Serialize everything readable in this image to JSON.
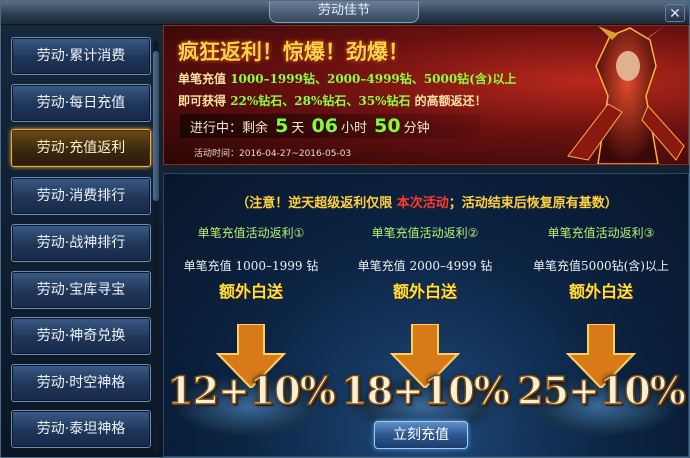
{
  "window": {
    "title": "劳动佳节",
    "close_label": "✕"
  },
  "sidebar": {
    "items": [
      {
        "label": "劳动·累计消费",
        "active": false
      },
      {
        "label": "劳动·每日充值",
        "active": false
      },
      {
        "label": "劳动·充值返利",
        "active": true
      },
      {
        "label": "劳动·消费排行",
        "active": false
      },
      {
        "label": "劳动·战神排行",
        "active": false
      },
      {
        "label": "劳动·宝库寻宝",
        "active": false
      },
      {
        "label": "劳动·神奇兑换",
        "active": false
      },
      {
        "label": "劳动·时空神格",
        "active": false
      },
      {
        "label": "劳动·泰坦神格",
        "active": false
      }
    ]
  },
  "banner": {
    "headline": "疯狂返利！惊爆！劲爆！",
    "line1_prefix": "单笔充值 ",
    "line1_ranges": "1000–1999钻、2000–4999钻、5000钻(含)以上",
    "line2_prefix": "即可获得 ",
    "line2_rates": "22%钻石、28%钻石、35%钻石",
    "line2_suffix": " 的高额返还！",
    "countdown": {
      "prefix": "进行中：剩余",
      "days": "5",
      "days_unit": "天",
      "hours": "06",
      "hours_unit": "小时",
      "minutes": "50",
      "minutes_unit": "分钟"
    },
    "date_text": "活动时间：2016-04-27~2016-05-03"
  },
  "notice": {
    "part1": "（注意！逆天超级返利仅限 ",
    "highlight": "本次活动",
    "part2": "；活动结束后恢复原有基数）"
  },
  "tiers": [
    {
      "title": "单笔充值活动返利①",
      "desc": "单笔充值 1000–1999 钻",
      "extra": "额外白送",
      "bonus": "12+10%"
    },
    {
      "title": "单笔充值活动返利②",
      "desc": "单笔充值 2000–4999 钻",
      "extra": "额外白送",
      "bonus": "18+10%"
    },
    {
      "title": "单笔充值活动返利③",
      "desc": "单笔充值5000钻(含)以上",
      "extra": "额外白送",
      "bonus": "25+10%"
    }
  ],
  "recharge_button": {
    "label": "立刻充值"
  },
  "colors": {
    "accent_gold": "#ffd040",
    "accent_green": "#8cff3c",
    "accent_red": "#ff3a2a"
  },
  "icons": {
    "close": "close-icon",
    "arrow": "arrow-down-icon"
  }
}
